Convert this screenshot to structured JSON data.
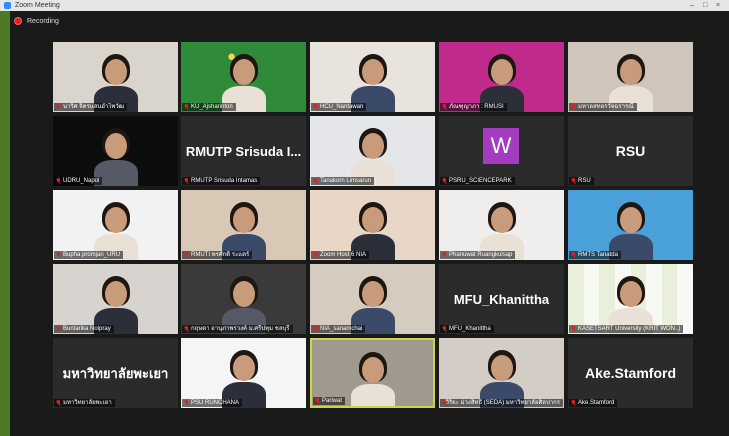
{
  "window": {
    "title": "Zoom Meeting",
    "controls": [
      "–",
      "□",
      "×"
    ]
  },
  "recording": {
    "label": "Recording"
  },
  "participants": [
    {
      "name": "นาริศ จิตรแสนอำไพวัฒ",
      "type": "video",
      "bg": "#d9d4cc",
      "active": false
    },
    {
      "name": "KU_Ajsharinton",
      "type": "video",
      "bg": "#2f8a3a",
      "active": false,
      "logo": "KUBIC"
    },
    {
      "name": "HCU_Nantawan",
      "type": "video",
      "bg": "#e9e3de",
      "active": false
    },
    {
      "name": "ภัณฑุญาภา : RMUSI",
      "type": "video",
      "bg": "#c02a8a",
      "active": false
    },
    {
      "name": "มหาลสทอรวัจฉรารณี",
      "type": "video",
      "bg": "#cfc5bb",
      "active": false
    },
    {
      "name": "UDRU_Napol",
      "type": "video",
      "bg": "#0c0c0c",
      "active": false
    },
    {
      "name": "RMUTP Srisuda Intamas",
      "type": "text",
      "label": "RMUTP Srisuda I...",
      "active": false
    },
    {
      "name": "Tanakorn Limsarun",
      "type": "video",
      "bg": "#e4e6ea",
      "active": false
    },
    {
      "name": "PSRU_SCIENCEPARK",
      "type": "avatar",
      "letter": "W",
      "active": false
    },
    {
      "name": "RSU",
      "type": "text",
      "label": "RSU",
      "active": false
    },
    {
      "name": "Bupha promjan_URU",
      "type": "video",
      "bg": "#f2f2f2",
      "active": false
    },
    {
      "name": "RMUTI พรศักดิ์ ระแตร์",
      "type": "video",
      "bg": "#d8c8b6",
      "active": false
    },
    {
      "name": "Zoom Host 6 NIA",
      "type": "video",
      "bg": "#e8d6c6",
      "active": false
    },
    {
      "name": "Phanuwat Ruangkulsap",
      "type": "video",
      "bg": "#efeeed",
      "active": false
    },
    {
      "name": "RMTS Tanatda",
      "type": "video",
      "bg": "#4aa0d8",
      "active": false
    },
    {
      "name": "Buntarika Noipray",
      "type": "video",
      "bg": "#d7d3cf",
      "active": false
    },
    {
      "name": "กฤษดา อานุภาพรวงค์ ม.ศรีปทุม ชลบุรี",
      "type": "video",
      "bg": "#3a3a3a",
      "active": false
    },
    {
      "name": "NIA_sanamchai",
      "type": "video",
      "bg": "#d5cbbf",
      "active": false
    },
    {
      "name": "MFU_Khanittha",
      "type": "text",
      "label": "MFU_Khanittha",
      "active": false
    },
    {
      "name": "KASETSART University (KRIT WON..)",
      "type": "video",
      "bg": "#f4f4f0",
      "active": false,
      "logo": "KU80"
    },
    {
      "name": "มหาวิทยาลัยพะเยา",
      "type": "text",
      "label": "มหาวิทยาลัยพะเยา",
      "active": false
    },
    {
      "name": "PSU RUNCHANA",
      "type": "video",
      "bg": "#f5f5f5",
      "active": false
    },
    {
      "name": "Pariwat",
      "type": "video",
      "bg": "#a09a8e",
      "active": true
    },
    {
      "name": "วิริยะ ม่วงสิทธิ์ (SEDA) มหาวิทยาลัยศิลปากร",
      "type": "video",
      "bg": "#d4cdc6",
      "active": false
    },
    {
      "name": "Ake.Stamford",
      "type": "text",
      "label": "Ake.Stamford",
      "active": false
    }
  ]
}
